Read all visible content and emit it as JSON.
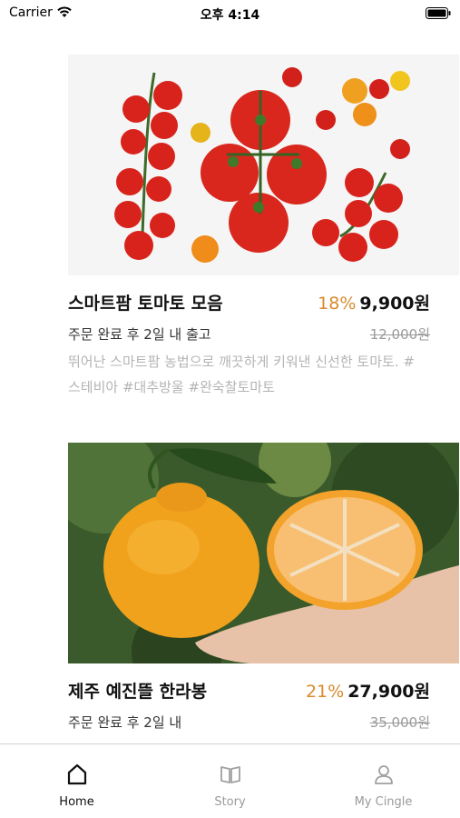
{
  "status_bar": {
    "carrier": "Carrier",
    "time": "오후 4:14"
  },
  "products": [
    {
      "title": "스마트팜 토마토 모음",
      "discount": "18%",
      "price": "9,900원",
      "shipping": "주문 완료 후 2일 내 출고",
      "original_price": "12,000원",
      "description": "뛰어난 스마트팜 농법으로 깨끗하게 키워낸 신선한 토마토. #스테비아 #대추방울 #완숙찰토마토"
    },
    {
      "title": "제주 예진뜰 한라봉",
      "discount": "21%",
      "price": "27,900원",
      "shipping": "주문 완료 후 2일 내",
      "original_price": "35,000원"
    }
  ],
  "tab_bar": {
    "tabs": [
      {
        "label": "Home",
        "icon": "home-icon",
        "active": true
      },
      {
        "label": "Story",
        "icon": "book-icon",
        "active": false
      },
      {
        "label": "My Cingle",
        "icon": "user-icon",
        "active": false
      }
    ]
  },
  "colors": {
    "accent_discount": "#d98a2b",
    "muted_text": "#b4b4b4",
    "strike_text": "#9a9a9a"
  }
}
